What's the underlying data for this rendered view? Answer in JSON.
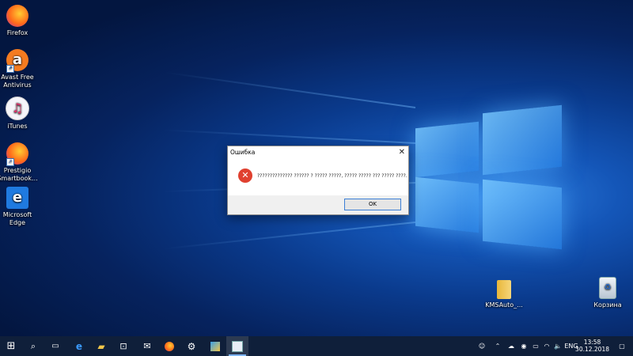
{
  "desktop": {
    "icons": [
      {
        "label_line1": "Firefox",
        "label_line2": "",
        "icon": "firefox-icon",
        "color": "#ff6a1a"
      },
      {
        "label_line1": "Avast Free",
        "label_line2": "Antivirus",
        "icon": "avast-icon",
        "color": "#f47b20"
      },
      {
        "label_line1": "iTunes",
        "label_line2": "",
        "icon": "itunes-icon",
        "color": "#e9e9ef"
      },
      {
        "label_line1": "Prestigio",
        "label_line2": "Smartbook...",
        "icon": "prestigio-firefox-icon",
        "color": "#ff6a1a"
      },
      {
        "label_line1": "Microsoft",
        "label_line2": "Edge",
        "icon": "edge-icon",
        "color": "#1f7ae0"
      },
      {
        "label_line1": "KMSAuto_...",
        "label_line2": "",
        "icon": "folder-icon",
        "color": "#f0c64a"
      },
      {
        "label_line1": "Корзина",
        "label_line2": "",
        "icon": "recycle-bin-icon",
        "color": "#d0d8e0"
      }
    ]
  },
  "dialog": {
    "title": "Ошибка",
    "message": "?????????????? ?????? ? ????? ?????, ????? ????? ??? ????? ????.",
    "ok_label": "OK",
    "close_glyph": "✕"
  },
  "taskbar": {
    "language": "ENG",
    "time": "13:58",
    "date": "30.12.2018"
  }
}
